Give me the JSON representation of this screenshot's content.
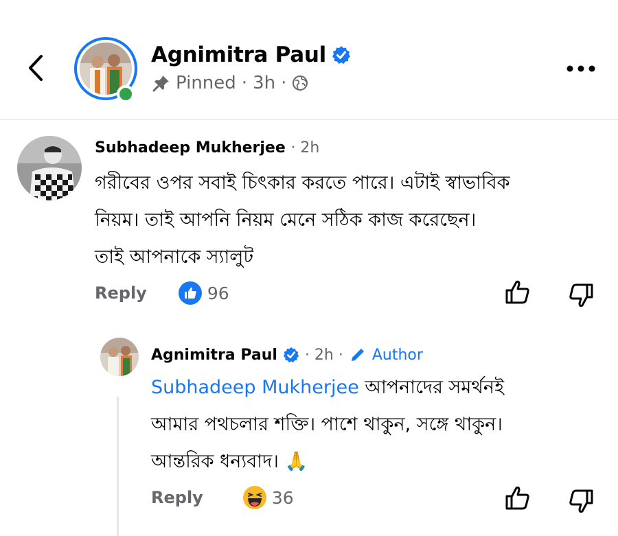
{
  "header": {
    "name": "Agnimitra Paul",
    "pinned": "Pinned",
    "time": "3h",
    "sep": "·"
  },
  "comments": [
    {
      "author": "Subhadeep Mukherjee",
      "time": "· 2h",
      "lines": [
        "গরীবের ওপর সবাই চিৎকার করতে পারে। এটাই স্বাভাবিক",
        "নিয়ম। তাই আপনি নিয়ম মেনে সঠিক কাজ করেছেন।",
        "তাই আপনাকে  স্যালুট"
      ],
      "reply_label": "Reply",
      "reaction_count": "96"
    },
    {
      "author": "Agnimitra Paul",
      "time": "· 2h ·",
      "badge": "Author",
      "mention": "Subhadeep Mukherjee",
      "line1_rest": " আপনাদের সমর্থনই",
      "line2": "আমার পথচলার শক্তি। পাশে থাকুন, সঙ্গে থাকুন।",
      "line3": "আন্তরিক ধন্যবাদ। 🙏",
      "reply_label": "Reply",
      "reaction_count": "36"
    }
  ],
  "colors": {
    "accent": "#1877f2",
    "secondary_text": "#65676b",
    "online": "#31a24c"
  }
}
